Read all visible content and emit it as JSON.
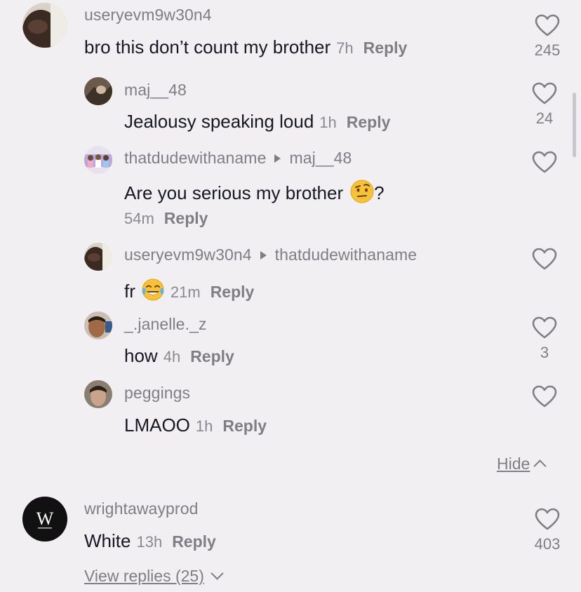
{
  "comments": [
    {
      "username": "useryevm9w30n4",
      "text": "bro this don’t count my brother",
      "time": "7h",
      "reply_label": "Reply",
      "likes": "245",
      "avatar": "dark-skin-face-avatar",
      "replies": [
        {
          "username": "maj__48",
          "text": "Jealousy speaking loud",
          "time": "1h",
          "reply_label": "Reply",
          "likes": "24",
          "avatar": "photo-avatar"
        },
        {
          "username": "thatdudewithaname",
          "reply_to": "maj__48",
          "text": "Are you serious my brother",
          "emoji": "face-with-raised-eyebrow",
          "text_suffix": "?",
          "time": "54m",
          "reply_label": "Reply",
          "likes": "",
          "avatar": "group-photo-avatar"
        },
        {
          "username": "useryevm9w30n4",
          "reply_to": "thatdudewithaname",
          "text": "fr",
          "emoji": "face-with-tears-of-joy",
          "time": "21m",
          "reply_label": "Reply",
          "likes": "",
          "avatar": "dark-skin-face-avatar"
        },
        {
          "username": "_.janelle._z",
          "text": "how",
          "time": "4h",
          "reply_label": "Reply",
          "likes": "3",
          "avatar": "selfie-avatar"
        },
        {
          "username": "peggings",
          "text": "LMAOO",
          "time": "1h",
          "reply_label": "Reply",
          "likes": "",
          "avatar": "face-avatar"
        }
      ],
      "hide_label": "Hide"
    },
    {
      "username": "wrightawayprod",
      "text": "White",
      "time": "13h",
      "reply_label": "Reply",
      "likes": "403",
      "avatar": "w-logo-avatar",
      "avatar_letter": "W",
      "view_replies_label": "View replies (25)"
    }
  ],
  "icons": {
    "like": "heart-outline-icon",
    "reply_arrow": "triangle-right-icon",
    "hide_chevron": "chevron-up-icon",
    "view_chevron": "chevron-down-icon"
  },
  "colors": {
    "background": "#f2eff2",
    "text": "#161823",
    "secondary": "#7f7e84"
  }
}
